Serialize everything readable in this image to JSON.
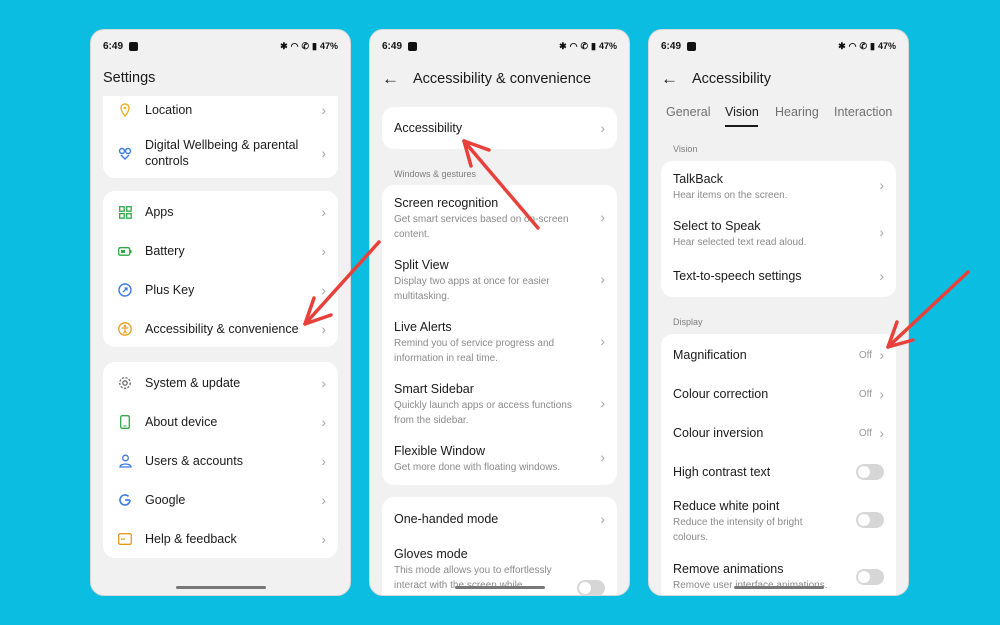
{
  "status": {
    "time": "6:49",
    "battery": "47%"
  },
  "screen1": {
    "title": "Settings",
    "group1": [
      {
        "label": "Location",
        "icon": "location-icon"
      },
      {
        "label": "Digital Wellbeing & parental",
        "label2": "controls",
        "icon": "wellbeing-icon"
      }
    ],
    "group2": [
      {
        "label": "Apps",
        "icon": "apps-icon"
      },
      {
        "label": "Battery",
        "icon": "battery-icon"
      },
      {
        "label": "Plus Key",
        "icon": "plus-key-icon"
      },
      {
        "label": "Accessibility & convenience",
        "icon": "accessibility-icon"
      }
    ],
    "group3": [
      {
        "label": "System & update",
        "icon": "gear-icon"
      },
      {
        "label": "About device",
        "icon": "device-icon"
      },
      {
        "label": "Users & accounts",
        "icon": "user-icon"
      },
      {
        "label": "Google",
        "icon": "google-icon"
      },
      {
        "label": "Help & feedback",
        "icon": "help-icon"
      }
    ]
  },
  "screen2": {
    "title": "Accessibility & convenience",
    "accessibility": "Accessibility",
    "section": "Windows & gestures",
    "items": [
      {
        "label": "Screen recognition",
        "sub1": "Get smart services based on on-screen",
        "sub2": "content."
      },
      {
        "label": "Split View",
        "sub1": "Display two apps at once for easier",
        "sub2": "multitasking."
      },
      {
        "label": "Live Alerts",
        "sub1": "Remind you of service progress and",
        "sub2": "information in real time."
      },
      {
        "label": "Smart Sidebar",
        "sub1": "Quickly launch apps or access functions",
        "sub2": "from the sidebar."
      },
      {
        "label": "Flexible Window",
        "sub1": "Get more done with floating windows."
      }
    ],
    "group3": [
      {
        "label": "One-handed mode"
      },
      {
        "label": "Gloves mode",
        "sub1": "This mode allows you to effortlessly",
        "sub2": "interact with the screen while"
      }
    ]
  },
  "screen3": {
    "title": "Accessibility",
    "tabs": [
      "General",
      "Vision",
      "Hearing",
      "Interaction"
    ],
    "active_tab": "Vision",
    "section_vision": "Vision",
    "vision_items": [
      {
        "label": "TalkBack",
        "sub": "Hear items on the screen."
      },
      {
        "label": "Select to Speak",
        "sub": "Hear selected text read aloud."
      },
      {
        "label": "Text-to-speech settings"
      }
    ],
    "section_display": "Display",
    "display_items": [
      {
        "label": "Magnification",
        "value": "Off"
      },
      {
        "label": "Colour correction",
        "value": "Off"
      },
      {
        "label": "Colour inversion",
        "value": "Off"
      },
      {
        "label": "High contrast text"
      },
      {
        "label": "Reduce white point",
        "sub1": "Reduce the intensity of bright",
        "sub2": "colours."
      },
      {
        "label": "Remove animations",
        "sub1": "Remove user interface animations."
      }
    ]
  },
  "colors": {
    "background": "#0bbde0",
    "annotation_arrow": "#e8403a"
  }
}
